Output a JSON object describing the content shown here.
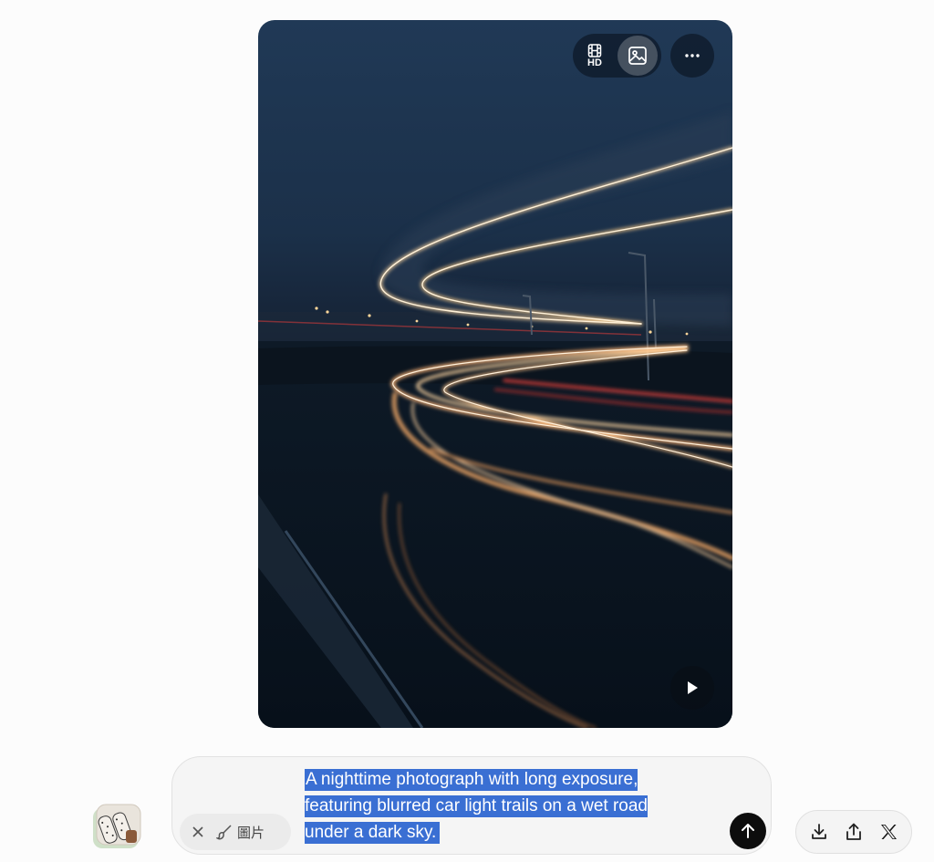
{
  "image_card": {
    "quality_label": "HD",
    "icons": {
      "video": "film-icon",
      "image": "image-icon",
      "more": "more-horizontal-icon",
      "play": "play-icon"
    }
  },
  "composer": {
    "prompt_text": "A nighttime photograph with long exposure, featuring blurred car light trails on a wet road under a dark sky.",
    "edit_chip_label": "圖片",
    "icons": {
      "clear": "close-icon",
      "edit": "brush-icon",
      "send": "arrow-up-icon"
    }
  },
  "actions": {
    "icons": [
      "download-icon",
      "share-icon",
      "x-logo-icon"
    ]
  },
  "colors": {
    "selection": "#3a6fd3",
    "send_button": "#0d0d0d",
    "page_background": "#fcfcfc"
  }
}
